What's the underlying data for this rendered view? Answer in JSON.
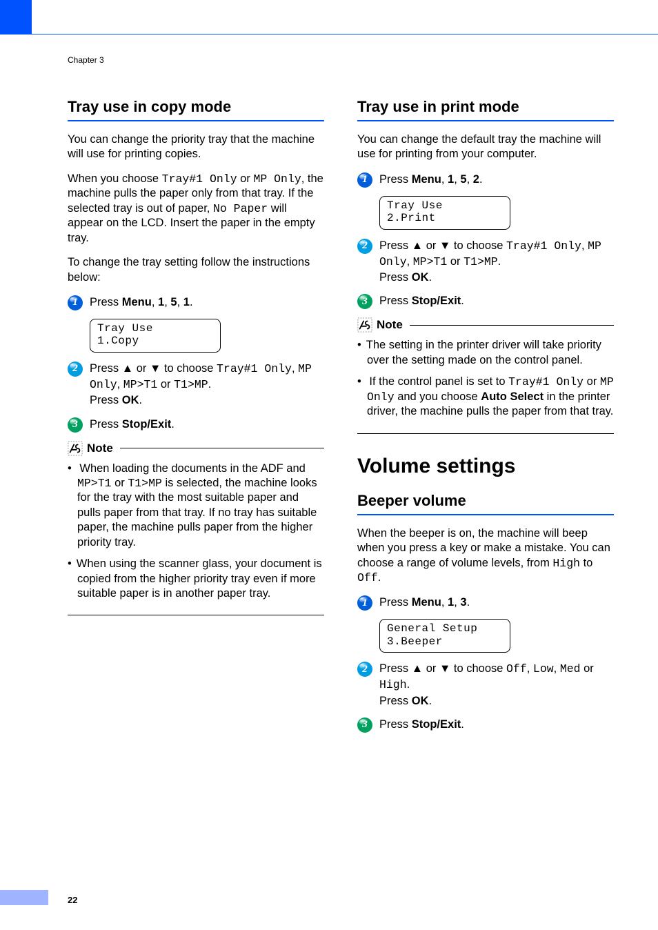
{
  "chapter": "Chapter 3",
  "page_number": "22",
  "left": {
    "h2": "Tray use in copy mode",
    "intro": "You can change the priority tray that the machine will use for printing copies.",
    "para2_a": "When you choose ",
    "para2_b": "Tray#1 Only",
    "para2_c": " or ",
    "para2_d": "MP Only",
    "para2_e": ", the machine pulls the paper only from that tray. If the selected tray is out of paper, ",
    "para2_f": "No Paper",
    "para2_g": " will appear on the LCD. Insert the paper in the empty tray.",
    "para3": "To change the tray setting follow the instructions below:",
    "step1_a": "Press ",
    "step1_b": "Menu",
    "step1_c": ", ",
    "step1_d": "1",
    "step1_e": ", ",
    "step1_f": "5",
    "step1_g": ", ",
    "step1_h": "1",
    "step1_i": ".",
    "lcd1_l1": "Tray Use",
    "lcd1_l2": "1.Copy",
    "step2_a": "Press ",
    "step2_up": "▲",
    "step2_b": " or ",
    "step2_dn": "▼",
    "step2_c": " to choose ",
    "step2_d": "Tray#1 Only",
    "step2_e": ", ",
    "step2_f": "MP Only",
    "step2_g": ", ",
    "step2_h": "MP>T1",
    "step2_i": " or ",
    "step2_j": "T1>MP",
    "step2_k": ".",
    "step2_l": "Press ",
    "step2_m": "OK",
    "step2_n": ".",
    "step3_a": "Press ",
    "step3_b": "Stop/Exit",
    "step3_c": ".",
    "note_label": "Note",
    "note1_a": "When loading the documents in the ADF and ",
    "note1_b": "MP>T1",
    "note1_c": " or ",
    "note1_d": "T1>MP",
    "note1_e": " is selected, the machine looks for the tray with the most suitable paper and pulls paper from that tray. If no tray has suitable paper, the machine pulls paper from the higher priority tray.",
    "note2": "When using the scanner glass, your document is copied from the higher priority tray even if more suitable paper is in another paper tray."
  },
  "right": {
    "h2a": "Tray use in print mode",
    "intro_a": "You can change the default tray the machine will use for printing from your computer.",
    "r_step1_a": "Press ",
    "r_step1_b": "Menu",
    "r_step1_c": ", ",
    "r_step1_d": "1",
    "r_step1_e": ", ",
    "r_step1_f": "5",
    "r_step1_g": ", ",
    "r_step1_h": "2",
    "r_step1_i": ".",
    "r_lcd1_l1": "Tray Use",
    "r_lcd1_l2": "2.Print",
    "r_step2_a": "Press ",
    "r_step2_up": "▲",
    "r_step2_b": " or ",
    "r_step2_dn": "▼",
    "r_step2_c": " to choose ",
    "r_step2_d": "Tray#1 Only",
    "r_step2_e": ", ",
    "r_step2_f": "MP Only",
    "r_step2_g": ", ",
    "r_step2_h": "MP>T1",
    "r_step2_i": " or ",
    "r_step2_j": "T1>MP",
    "r_step2_k": ".",
    "r_step2_l": "Press ",
    "r_step2_m": "OK",
    "r_step2_n": ".",
    "r_step3_a": "Press ",
    "r_step3_b": "Stop/Exit",
    "r_step3_c": ".",
    "note_label": "Note",
    "rnote1": "The setting in the printer driver will take priority over the setting made on the control panel.",
    "rnote2_a": "If the control panel is set to ",
    "rnote2_b": "Tray#1 Only",
    "rnote2_c": " or ",
    "rnote2_d": "MP Only",
    "rnote2_e": " and you choose ",
    "rnote2_f": "Auto Select",
    "rnote2_g": " in the printer driver, the machine pulls the paper from that tray.",
    "h1": "Volume settings",
    "h2b": "Beeper volume",
    "beeper_intro_a": "When the beeper is on, the machine will beep when you press a key or make a mistake. You can choose a range of volume levels, from ",
    "beeper_intro_b": "High",
    "beeper_intro_c": " to ",
    "beeper_intro_d": "Off",
    "beeper_intro_e": ".",
    "b_step1_a": "Press ",
    "b_step1_b": "Menu",
    "b_step1_c": ", ",
    "b_step1_d": "1",
    "b_step1_e": ", ",
    "b_step1_f": "3",
    "b_step1_g": ".",
    "b_lcd1_l1": "General Setup",
    "b_lcd1_l2": "3.Beeper",
    "b_step2_a": "Press ",
    "b_step2_up": "▲",
    "b_step2_b": " or ",
    "b_step2_dn": "▼",
    "b_step2_c": " to choose ",
    "b_step2_d": "Off",
    "b_step2_e": ", ",
    "b_step2_f": "Low",
    "b_step2_g": ", ",
    "b_step2_h": "Med",
    "b_step2_i": " or ",
    "b_step2_j": "High",
    "b_step2_k": ".",
    "b_step2_l": "Press ",
    "b_step2_m": "OK",
    "b_step2_n": ".",
    "b_step3_a": "Press ",
    "b_step3_b": "Stop/Exit",
    "b_step3_c": "."
  }
}
